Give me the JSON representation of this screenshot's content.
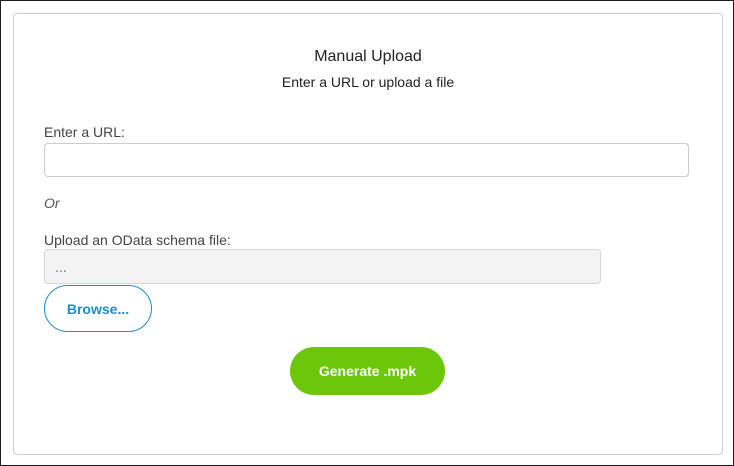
{
  "header": {
    "title": "Manual Upload",
    "subtitle": "Enter a URL or upload a file"
  },
  "url_section": {
    "label": "Enter a URL:",
    "value": "",
    "placeholder": ""
  },
  "separator": {
    "text": "Or"
  },
  "file_section": {
    "label": "Upload an OData schema file:",
    "placeholder": "...",
    "browse_label": "Browse..."
  },
  "actions": {
    "generate_label": "Generate .mpk"
  },
  "colors": {
    "accent_blue": "#1a8fc9",
    "generate_green": "#6cc70a"
  }
}
